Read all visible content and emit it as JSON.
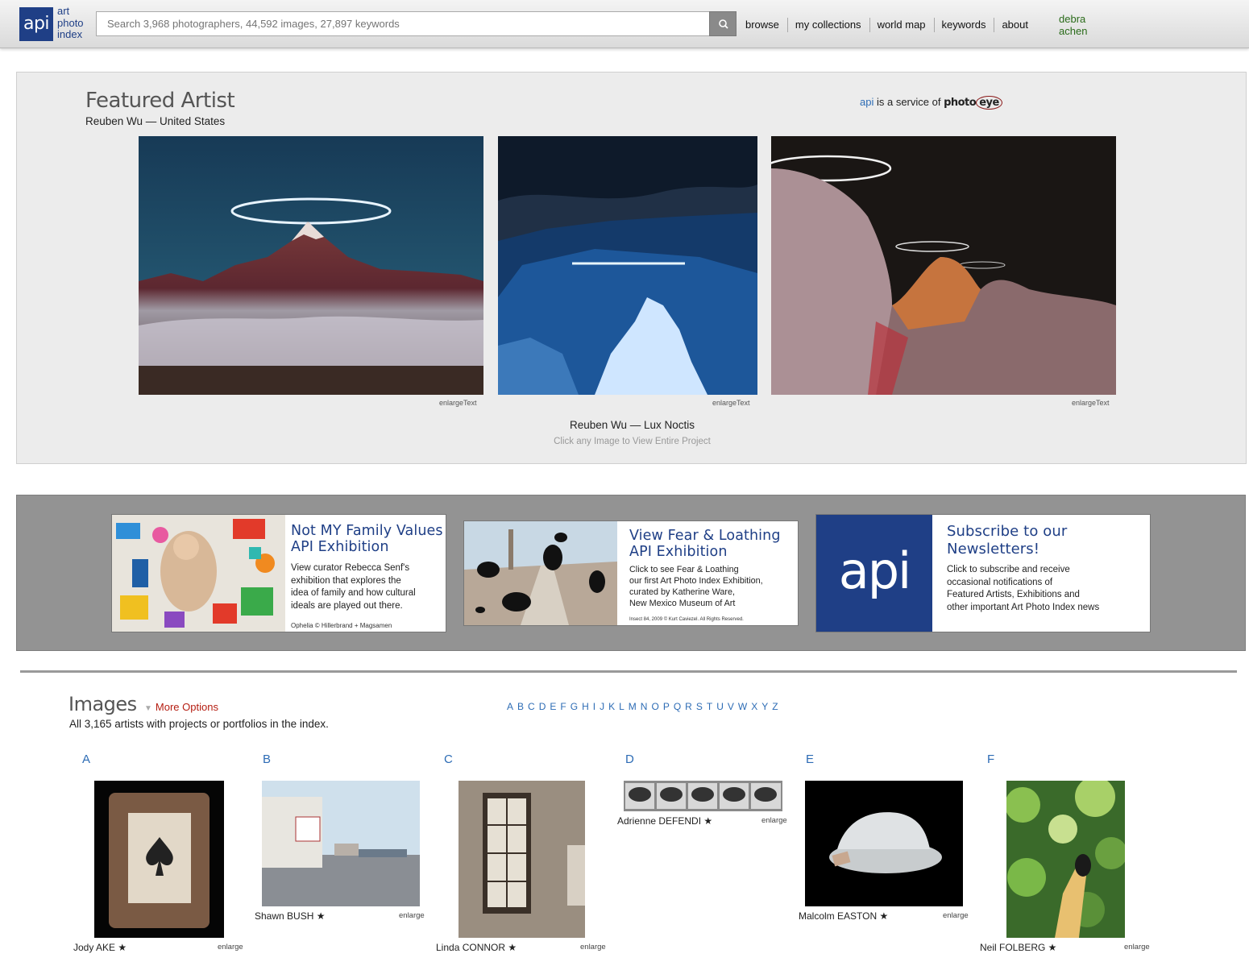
{
  "header": {
    "logo_mark": "api",
    "logo_words": [
      "art",
      "photo",
      "index"
    ],
    "search_placeholder": "Search 3,968 photographers, 44,592 images, 27,897 keywords",
    "nav": [
      "browse",
      "my collections",
      "world map",
      "keywords",
      "about"
    ],
    "user": [
      "debra",
      "achen"
    ]
  },
  "featured": {
    "title": "Featured Artist",
    "artist_line": "Reuben Wu — United States",
    "service_prefix": "api",
    "service_middle": " is a service of ",
    "service_brand_a": "photo",
    "service_brand_b": "eye",
    "enlarge_label": "enlargeText",
    "project_title": "Reuben Wu — Lux Noctis",
    "project_hint": "Click any Image to View Entire Project"
  },
  "promos": [
    {
      "title_lines": [
        "Not MY Family Values",
        "API Exhibition"
      ],
      "text_lines": [
        "View curator Rebecca Senf's",
        "exhibition that explores the",
        "idea of family and how cultural",
        "ideals are played out there."
      ],
      "credit": "Ophelia © Hillerbrand + Magsamen"
    },
    {
      "title_lines": [
        "View Fear & Loathing",
        "API Exhibition"
      ],
      "text_lines": [
        "Click to see Fear & Loathing",
        "our first Art Photo Index Exhibition,",
        "curated by Katherine Ware,",
        "New Mexico Museum of Art"
      ],
      "credit": "Insect 84, 2009 © Kurt Caviezel. All Rights Reserved."
    },
    {
      "logo": "api",
      "title_lines": [
        "Subscribe to our",
        "Newsletters!"
      ],
      "text_lines": [
        "Click to subscribe and receive",
        "occasional notifications of",
        "Featured Artists, Exhibitions and",
        "other important Art Photo Index news"
      ]
    }
  ],
  "images": {
    "title": "Images",
    "more_options": "More Options",
    "count_text": "All 3,165 artists with projects or portfolios in the index.",
    "alphabet": [
      "A",
      "B",
      "C",
      "D",
      "E",
      "F",
      "G",
      "H",
      "I",
      "J",
      "K",
      "L",
      "M",
      "N",
      "O",
      "P",
      "Q",
      "R",
      "S",
      "T",
      "U",
      "V",
      "W",
      "X",
      "Y",
      "Z"
    ],
    "enlarge_label": "enlarge",
    "columns": [
      {
        "letter": "A",
        "artist": "Jody AKE ★"
      },
      {
        "letter": "B",
        "artist": "Shawn BUSH ★"
      },
      {
        "letter": "C",
        "artist": "Linda CONNOR ★"
      },
      {
        "letter": "D",
        "artist": "Adrienne DEFENDI ★"
      },
      {
        "letter": "E",
        "artist": "Malcolm EASTON ★"
      },
      {
        "letter": "F",
        "artist": "Neil FOLBERG ★"
      }
    ]
  },
  "colors": {
    "brand_blue": "#1f3f86",
    "link_blue": "#2d6cb5",
    "user_green": "#2a6b1a",
    "more_red": "#b51e12"
  }
}
